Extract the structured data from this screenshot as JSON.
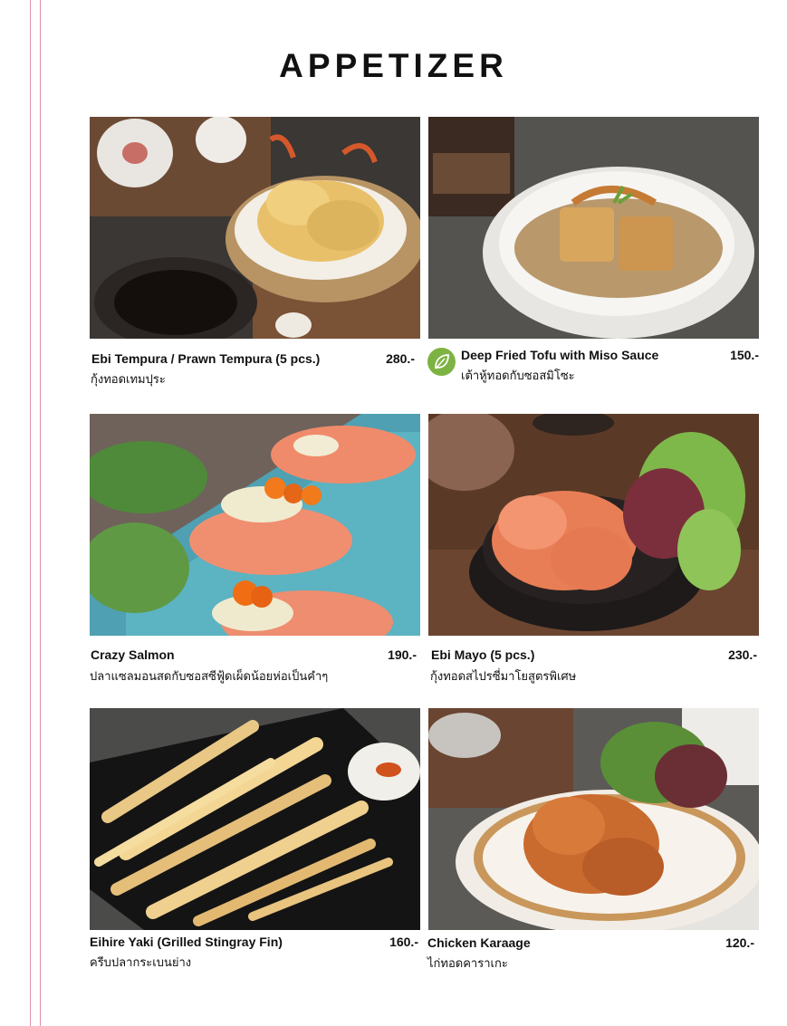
{
  "page": {
    "title": "APPETIZER"
  },
  "items": [
    {
      "name": "Ebi Tempura / Prawn Tempura (5 pcs.)",
      "thai": "กุ้งทอดเทมปุระ",
      "price": "280.-"
    },
    {
      "name": "Deep Fried Tofu with Miso Sauce",
      "thai": "เต้าหู้ทอดกับซอสมิโซะ",
      "price": "150.-",
      "badge": "leaf-icon"
    },
    {
      "name": "Crazy Salmon",
      "thai": "ปลาแซลมอนสดกับซอสซีฟู้ดเผ็ดน้อยห่อเป็นคำๆ",
      "price": "190.-"
    },
    {
      "name": "Ebi Mayo (5 pcs.)",
      "thai": "กุ้งทอดสไปรซี่มาโยสูตรพิเศษ",
      "price": "230.-"
    },
    {
      "name": "Eihire Yaki  (Grilled Stingray Fin)",
      "thai": "ครีบปลากระเบนย่าง",
      "price": "160.-"
    },
    {
      "name": "Chicken Karaage",
      "thai": "ไก่ทอดคาราเกะ",
      "price": "120.-"
    }
  ],
  "colors": {
    "margin_line": "#e08fb0",
    "veg_badge": "#7db342"
  }
}
